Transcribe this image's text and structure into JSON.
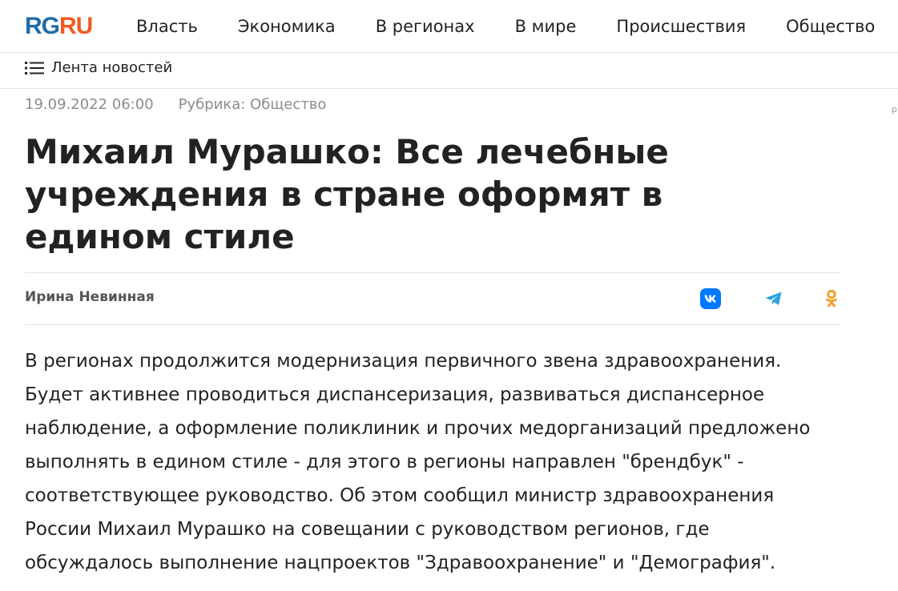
{
  "header": {
    "logo": {
      "part1": "RG",
      "part2": "RU"
    },
    "nav": [
      "Власть",
      "Экономика",
      "В регионах",
      "В мире",
      "Происшествия",
      "Общество"
    ]
  },
  "subbar": {
    "feed_label": "Лента новостей"
  },
  "article": {
    "date": "19.09.2022 06:00",
    "rubric": "Рубрика: Общество",
    "title": "Михаил Мурашко: Все лечебные учреждения в стране оформят в едином стиле",
    "author": "Ирина Невинная",
    "lead": "В регионах продолжится модернизация первичного звена здравоохранения. Будет активнее проводиться диспансеризация, развиваться диспансерное наблюдение, а оформление поликлиник и прочих медорганизаций предложено выполнять в едином стиле - для этого в регионы направлен \"брендбук\" - соответствующее руководство. Об этом сообщил министр здравоохранения России Михаил Мурашко на совещании с руководством регионов, где обсуждалось выполнение нацпроектов \"Здравоохранение\" и \"Демография\"."
  },
  "share": {
    "icons": [
      "vk-icon",
      "telegram-icon",
      "odnoklassniki-icon"
    ],
    "colors": {
      "vk": "#0077ff",
      "telegram": "#2aa3e0",
      "ok": "#f29c1f"
    }
  },
  "colors": {
    "logo_rg": "#1f6ca8",
    "logo_ru": "#f15a24",
    "meta": "#8c8c8c"
  },
  "edge_mark": "р"
}
